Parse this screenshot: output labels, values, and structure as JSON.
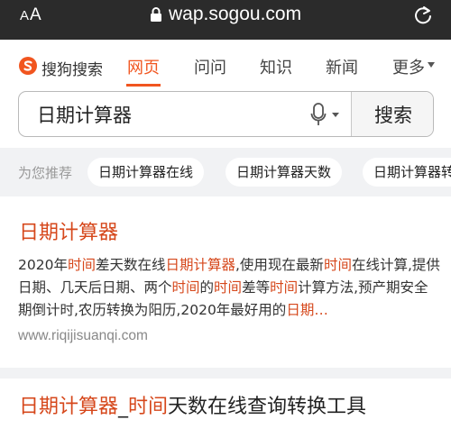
{
  "browser": {
    "aa_label_small": "A",
    "aa_label_large": "A",
    "url": "wap.sogou.com"
  },
  "nav": {
    "brand": "搜狗搜索",
    "tabs": [
      {
        "label": "网页",
        "active": true
      },
      {
        "label": "问问"
      },
      {
        "label": "知识"
      },
      {
        "label": "新闻"
      },
      {
        "label": "更多"
      }
    ]
  },
  "search": {
    "query": "日期计算器",
    "button_label": "搜索"
  },
  "suggestions": {
    "label": "为您推荐",
    "items": [
      "日期计算器在线",
      "日期计算器天数",
      "日期计算器转"
    ]
  },
  "results": [
    {
      "title": "日期计算器",
      "snippet": [
        {
          "t": "2020年",
          "h": false
        },
        {
          "t": "时间",
          "h": true
        },
        {
          "t": "差天数在线",
          "h": false
        },
        {
          "t": "日期计算器",
          "h": true
        },
        {
          "t": ",使用现在最新",
          "h": false
        },
        {
          "t": "时间",
          "h": true
        },
        {
          "t": "在线计算,提供日期、几天后日期、两个",
          "h": false
        },
        {
          "t": "时间",
          "h": true
        },
        {
          "t": "的",
          "h": false
        },
        {
          "t": "时间",
          "h": true
        },
        {
          "t": "差等",
          "h": false
        },
        {
          "t": "时间",
          "h": true
        },
        {
          "t": "计算方法,预产期安全期倒计时,农历转换为阳历,2020年最好用的",
          "h": false
        },
        {
          "t": "日期…",
          "h": true
        }
      ],
      "url": "www.riqijisuanqi.com"
    },
    {
      "title_parts": [
        {
          "t": "日期计算器",
          "h": true
        },
        {
          "t": "_",
          "h": false
        },
        {
          "t": "时间",
          "h": true
        },
        {
          "t": "天数在线查询转换工具",
          "h": false
        }
      ]
    }
  ],
  "colors": {
    "accent": "#f1551f",
    "highlight": "#d6481c",
    "address_bar": "#2b2b2b"
  }
}
